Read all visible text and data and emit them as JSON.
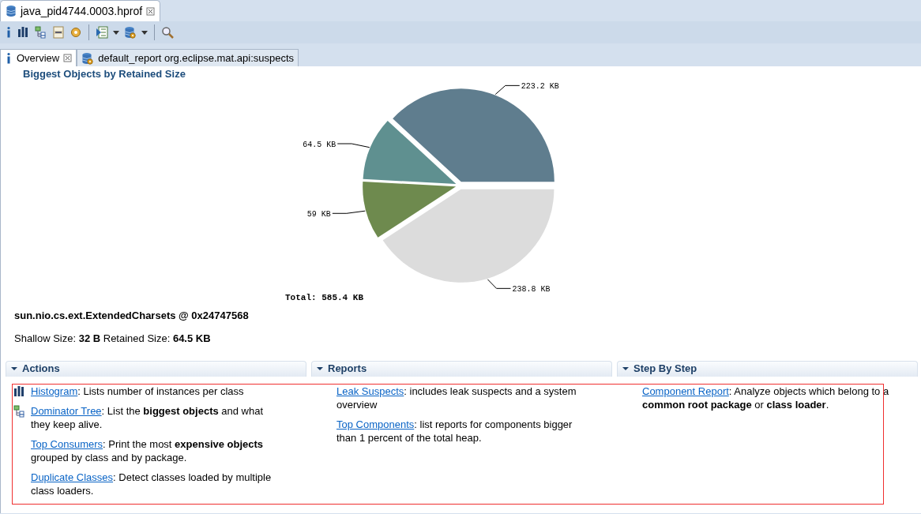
{
  "editor_tabs": [
    {
      "label": "java_pid4744.0003.hprof",
      "selected": true
    }
  ],
  "inner_tabs": [
    {
      "label": "Overview",
      "selected": true,
      "closable": true
    },
    {
      "label": "default_report  org.eclipse.mat.api:suspects",
      "selected": false,
      "closable": false
    }
  ],
  "overview": {
    "heading": "Biggest Objects by Retained Size",
    "chart_data": {
      "type": "pie",
      "values": [
        223.2,
        64.5,
        59,
        238.8
      ],
      "value_labels": [
        "223.2 KB",
        "64.5 KB",
        "59 KB",
        "238.8 KB"
      ],
      "colors": [
        "#5f7d8e",
        "#5f9090",
        "#6e8a4e",
        "#dcdcdc"
      ],
      "annotations": [
        "Total: 585.4 KB"
      ]
    },
    "object_name": "sun.nio.cs.ext.ExtendedCharsets @ 0x24747568",
    "sizes": "Shallow Size: **32 B** Retained Size: **64.5 KB**"
  },
  "sections": [
    {
      "title": "Actions",
      "expanded": true,
      "items": [
        {
          "link": "Histogram",
          "text": ": Lists number of instances per class"
        },
        {
          "link": "Dominator Tree",
          "text": ": List the **biggest objects** and what they keep alive."
        },
        {
          "link": "Top Consumers",
          "text": ": Print the most **expensive objects** grouped by class and by package."
        },
        {
          "link": "Duplicate Classes",
          "text": ": Detect classes loaded by multiple class loaders."
        }
      ]
    },
    {
      "title": "Reports",
      "expanded": true,
      "items": [
        {
          "link": "Leak Suspects",
          "text": ": includes leak suspects and a system overview"
        },
        {
          "link": "Top Components",
          "text": ": list reports for components bigger than 1 percent of the total heap."
        }
      ]
    },
    {
      "title": "Step By Step",
      "expanded": true,
      "items": [
        {
          "link": "Component Report",
          "text": ": Analyze objects which belong to a **common root package** or **class loader**."
        }
      ]
    }
  ]
}
